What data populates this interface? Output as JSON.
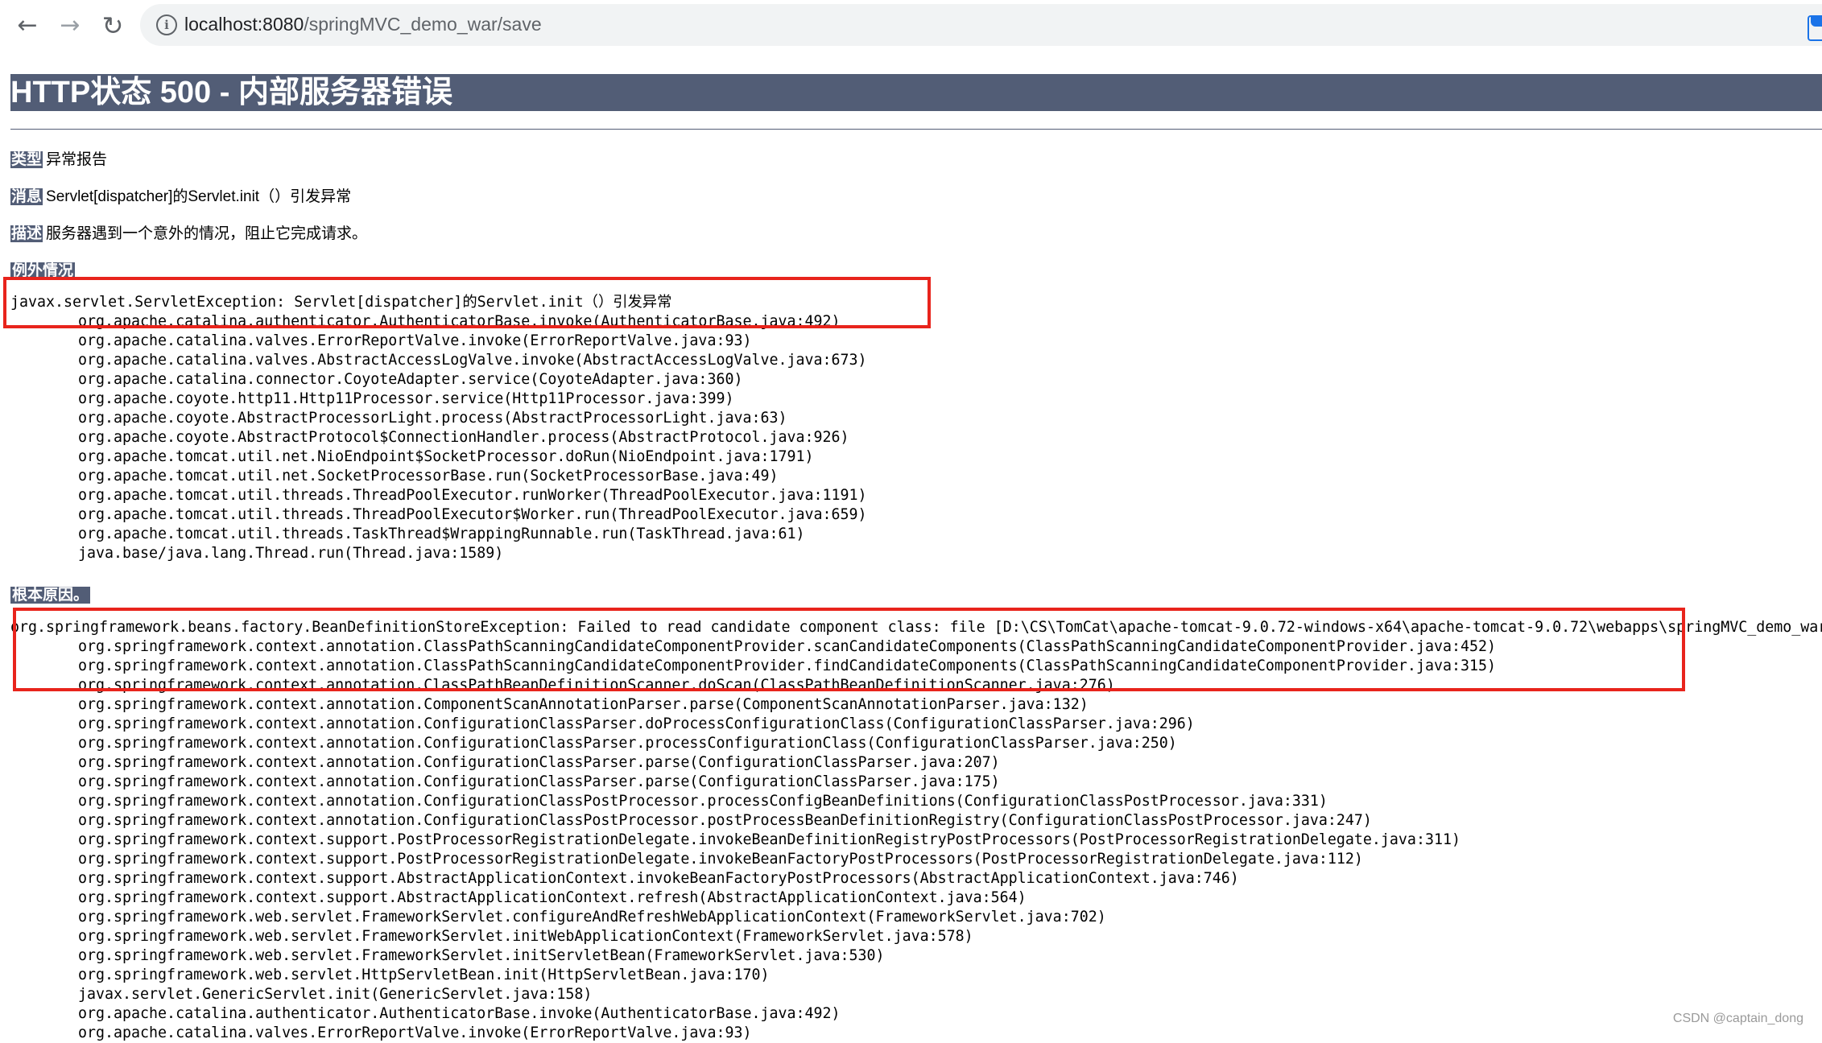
{
  "browser": {
    "url_host": "localhost:8080",
    "url_path": "/springMVC_demo_war/save"
  },
  "page": {
    "title": "HTTP状态 500 - 内部服务器错误",
    "type_label": "类型",
    "type_value": "异常报告",
    "message_label": "消息",
    "message_value": "Servlet[dispatcher]的Servlet.init（）引发异常",
    "description_label": "描述",
    "description_value": "服务器遇到一个意外的情况，阻止它完成请求。",
    "exception_label": "例外情况",
    "root_cause_label": "根本原因。"
  },
  "exception_trace": [
    "javax.servlet.ServletException: Servlet[dispatcher]的Servlet.init（）引发异常",
    "org.apache.catalina.authenticator.AuthenticatorBase.invoke(AuthenticatorBase.java:492)",
    "org.apache.catalina.valves.ErrorReportValve.invoke(ErrorReportValve.java:93)",
    "org.apache.catalina.valves.AbstractAccessLogValve.invoke(AbstractAccessLogValve.java:673)",
    "org.apache.catalina.connector.CoyoteAdapter.service(CoyoteAdapter.java:360)",
    "org.apache.coyote.http11.Http11Processor.service(Http11Processor.java:399)",
    "org.apache.coyote.AbstractProcessorLight.process(AbstractProcessorLight.java:63)",
    "org.apache.coyote.AbstractProtocol$ConnectionHandler.process(AbstractProtocol.java:926)",
    "org.apache.tomcat.util.net.NioEndpoint$SocketProcessor.doRun(NioEndpoint.java:1791)",
    "org.apache.tomcat.util.net.SocketProcessorBase.run(SocketProcessorBase.java:49)",
    "org.apache.tomcat.util.threads.ThreadPoolExecutor.runWorker(ThreadPoolExecutor.java:1191)",
    "org.apache.tomcat.util.threads.ThreadPoolExecutor$Worker.run(ThreadPoolExecutor.java:659)",
    "org.apache.tomcat.util.threads.TaskThread$WrappingRunnable.run(TaskThread.java:61)",
    "java.base/java.lang.Thread.run(Thread.java:1589)"
  ],
  "root_cause_trace": [
    "org.springframework.beans.factory.BeanDefinitionStoreException: Failed to read candidate component class: file [D:\\CS\\TomCat\\apache-tomcat-9.0.72-windows-x64\\apache-tomcat-9.0.72\\webapps\\springMVC_demo_war\\WEB-INF\\",
    "org.springframework.context.annotation.ClassPathScanningCandidateComponentProvider.scanCandidateComponents(ClassPathScanningCandidateComponentProvider.java:452)",
    "org.springframework.context.annotation.ClassPathScanningCandidateComponentProvider.findCandidateComponents(ClassPathScanningCandidateComponentProvider.java:315)",
    "org.springframework.context.annotation.ClassPathBeanDefinitionScanner.doScan(ClassPathBeanDefinitionScanner.java:276)",
    "org.springframework.context.annotation.ComponentScanAnnotationParser.parse(ComponentScanAnnotationParser.java:132)",
    "org.springframework.context.annotation.ConfigurationClassParser.doProcessConfigurationClass(ConfigurationClassParser.java:296)",
    "org.springframework.context.annotation.ConfigurationClassParser.processConfigurationClass(ConfigurationClassParser.java:250)",
    "org.springframework.context.annotation.ConfigurationClassParser.parse(ConfigurationClassParser.java:207)",
    "org.springframework.context.annotation.ConfigurationClassParser.parse(ConfigurationClassParser.java:175)",
    "org.springframework.context.annotation.ConfigurationClassPostProcessor.processConfigBeanDefinitions(ConfigurationClassPostProcessor.java:331)",
    "org.springframework.context.annotation.ConfigurationClassPostProcessor.postProcessBeanDefinitionRegistry(ConfigurationClassPostProcessor.java:247)",
    "org.springframework.context.support.PostProcessorRegistrationDelegate.invokeBeanDefinitionRegistryPostProcessors(PostProcessorRegistrationDelegate.java:311)",
    "org.springframework.context.support.PostProcessorRegistrationDelegate.invokeBeanFactoryPostProcessors(PostProcessorRegistrationDelegate.java:112)",
    "org.springframework.context.support.AbstractApplicationContext.invokeBeanFactoryPostProcessors(AbstractApplicationContext.java:746)",
    "org.springframework.context.support.AbstractApplicationContext.refresh(AbstractApplicationContext.java:564)",
    "org.springframework.web.servlet.FrameworkServlet.configureAndRefreshWebApplicationContext(FrameworkServlet.java:702)",
    "org.springframework.web.servlet.FrameworkServlet.initWebApplicationContext(FrameworkServlet.java:578)",
    "org.springframework.web.servlet.FrameworkServlet.initServletBean(FrameworkServlet.java:530)",
    "org.springframework.web.servlet.HttpServletBean.init(HttpServletBean.java:170)",
    "javax.servlet.GenericServlet.init(GenericServlet.java:158)",
    "org.apache.catalina.authenticator.AuthenticatorBase.invoke(AuthenticatorBase.java:492)",
    "org.apache.catalina.valves.ErrorReportValve.invoke(ErrorReportValve.java:93)"
  ],
  "watermark": "CSDN @captain_dong",
  "colors": {
    "header_bg": "#525d76",
    "highlight_box": "#e8241c"
  }
}
